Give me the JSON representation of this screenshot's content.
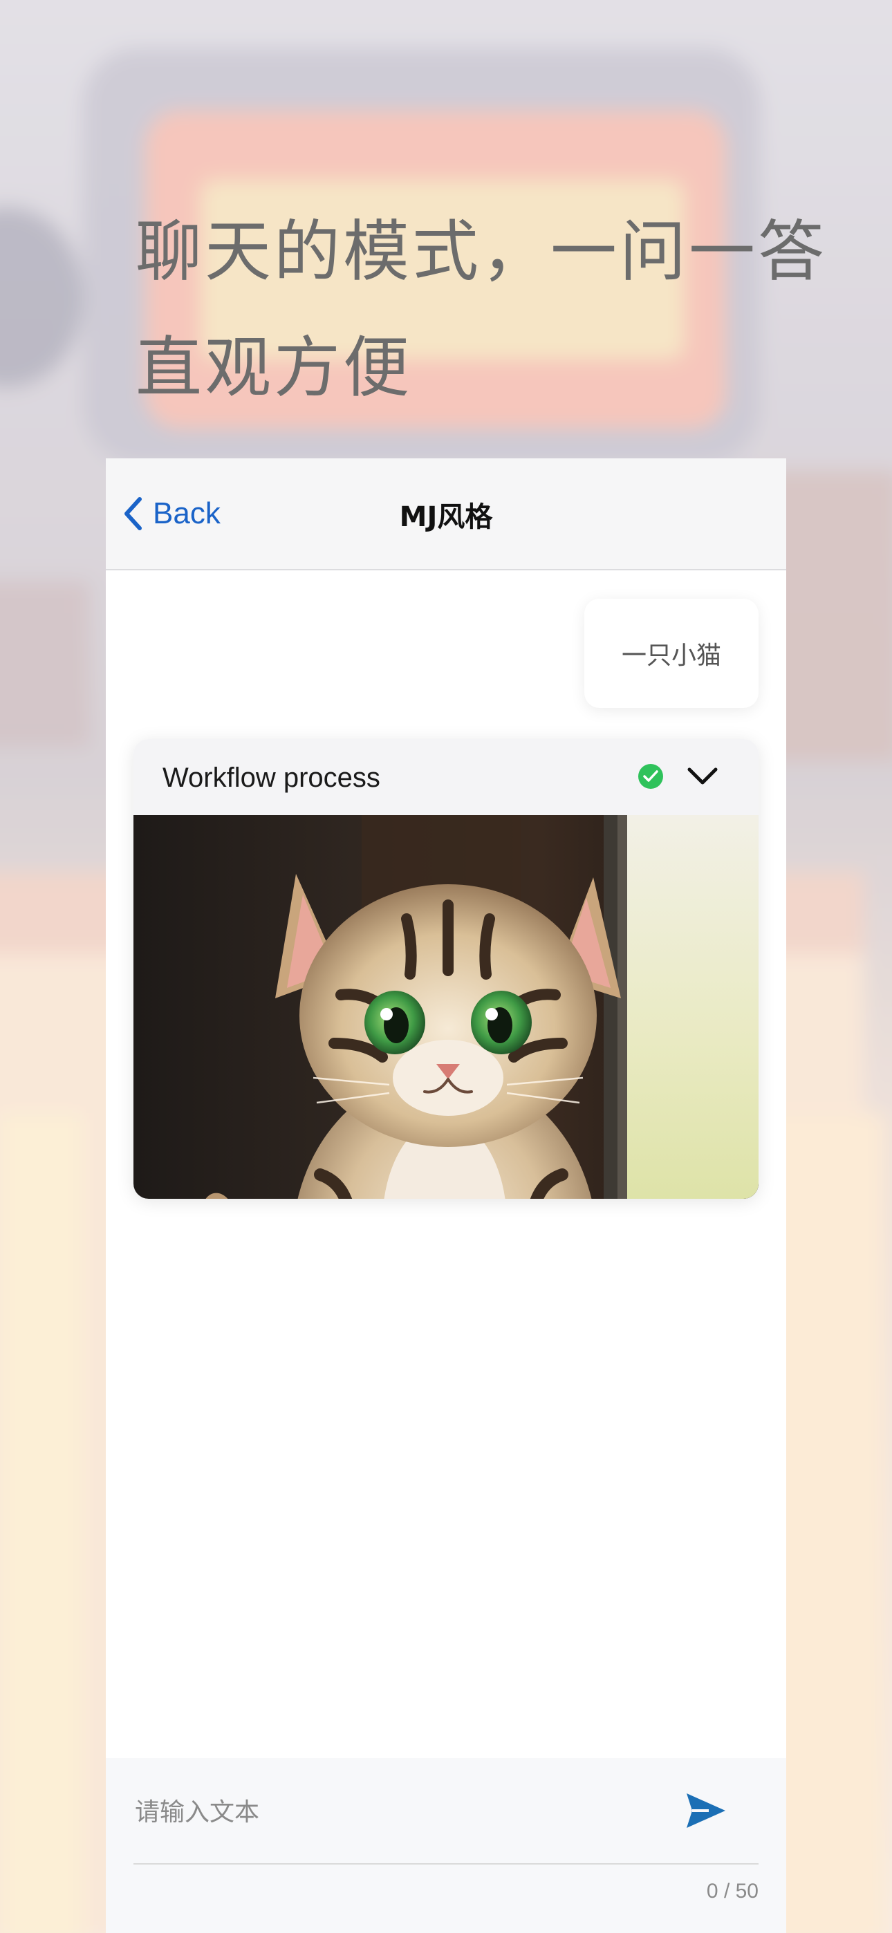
{
  "headline": {
    "line1": "聊天的模式，一问一答",
    "line2": "直观方便"
  },
  "navbar": {
    "back_label": "Back",
    "title": "MJ风格"
  },
  "chat": {
    "user_message": "一只小猫",
    "workflow_card": {
      "title": "Workflow process",
      "status": "success",
      "image_subject": "tabby kitten sitting on a wooden windowsill",
      "actions": [
        "share-icon",
        "heart-icon"
      ]
    }
  },
  "composer": {
    "placeholder": "请输入文本",
    "value": "",
    "count": "0",
    "separator": " / ",
    "max": "50"
  },
  "colors": {
    "accent_blue": "#1a63c8",
    "send_blue": "#1b6fb5",
    "success_green": "#2fc25b",
    "headline_gray": "#6c6c6c"
  }
}
